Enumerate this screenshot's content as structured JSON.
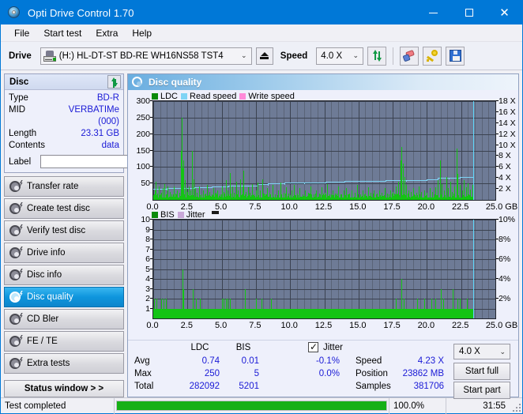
{
  "window": {
    "title": "Opti Drive Control 1.70",
    "icon": "disc-icon",
    "minimize": "minimize",
    "maximize": "maximize",
    "close": "close"
  },
  "menu": {
    "items": [
      "File",
      "Start test",
      "Extra",
      "Help"
    ]
  },
  "toolbar": {
    "drive_label": "Drive",
    "drive_value": "(H:)  HL-DT-ST BD-RE  WH16NS58 TST4",
    "eject_title": "Eject",
    "speed_label": "Speed",
    "speed_value": "4.0 X",
    "refresh_title": "refresh-icon",
    "erase_title": "erase-icon",
    "key_title": "key-icon",
    "save_title": "save-icon"
  },
  "disc_panel": {
    "title": "Disc",
    "refresh_icon": "refresh-icon",
    "rows": [
      {
        "key": "Type",
        "value": "BD-R"
      },
      {
        "key": "MID",
        "value": "VERBATIMe (000)"
      },
      {
        "key": "Length",
        "value": "23.31 GB"
      },
      {
        "key": "Contents",
        "value": "data"
      }
    ],
    "label_key": "Label",
    "label_value": "",
    "label_placeholder": ""
  },
  "nav": {
    "items": [
      {
        "label": "Transfer rate",
        "active": false
      },
      {
        "label": "Create test disc",
        "active": false
      },
      {
        "label": "Verify test disc",
        "active": false
      },
      {
        "label": "Drive info",
        "active": false
      },
      {
        "label": "Disc info",
        "active": false
      },
      {
        "label": "Disc quality",
        "active": true
      },
      {
        "label": "CD Bler",
        "active": false
      },
      {
        "label": "FE / TE",
        "active": false
      },
      {
        "label": "Extra tests",
        "active": false
      }
    ],
    "status_button": "Status window > >"
  },
  "main": {
    "title": "Disc quality",
    "icon": "disc-quality-icon"
  },
  "stats": {
    "col_ldc": "LDC",
    "col_bis": "BIS",
    "jitter_label": "Jitter",
    "jitter_checked": true,
    "rows": [
      {
        "name": "Avg",
        "ldc": "0.74",
        "bis": "0.01",
        "jitter": "-0.1%"
      },
      {
        "name": "Max",
        "ldc": "250",
        "bis": "5",
        "jitter": "0.0%"
      },
      {
        "name": "Total",
        "ldc": "282092",
        "bis": "5201",
        "jitter": ""
      }
    ],
    "speed_label": "Speed",
    "speed_value": "4.23 X",
    "position_label": "Position",
    "position_value": "23862 MB",
    "samples_label": "Samples",
    "samples_value": "381706",
    "speed_select": "4.0 X",
    "start_full": "Start full",
    "start_part": "Start part"
  },
  "statusbar": {
    "message": "Test completed",
    "progress_percent": "100.0%",
    "progress_value": 100,
    "elapsed": "31:55"
  },
  "colors": {
    "accent": "#0078d7",
    "ldc_green": "#14c414",
    "read_speed": "#7fd4f5",
    "write_speed": "#ff8ad8",
    "jitter": "#c9a8d8",
    "plot_bg": "#6e7b96",
    "value_blue": "#1a1ad6"
  },
  "chart_data": [
    {
      "type": "line",
      "id": "ldc-chart",
      "title": "Disc quality - LDC / Read speed",
      "legend": [
        {
          "label": "LDC",
          "color": "#0a8a0a"
        },
        {
          "label": "Read speed",
          "color": "#7fd4f5"
        },
        {
          "label": "Write speed",
          "color": "#ff8ad8"
        }
      ],
      "legend_position": "top-left",
      "xlabel": "GB",
      "xlim": [
        0,
        25
      ],
      "xticks": [
        "0.0",
        "2.5",
        "5.0",
        "7.5",
        "10.0",
        "12.5",
        "15.0",
        "17.5",
        "20.0",
        "22.5",
        "25.0 GB"
      ],
      "ylabel_left": "LDC",
      "ylim": [
        0,
        300
      ],
      "yticks": [
        50,
        100,
        150,
        200,
        250,
        300
      ],
      "ylabel_right": "Speed",
      "ylim_right": [
        0,
        18
      ],
      "yticks_right": [
        "2 X",
        "4 X",
        "6 X",
        "8 X",
        "10 X",
        "12 X",
        "14 X",
        "16 X",
        "18 X"
      ],
      "grid": true,
      "cursor_x": 23.4,
      "series": [
        {
          "name": "Read speed",
          "color": "#7fd4f5",
          "axis": "right",
          "x": [
            0.0,
            1.0,
            2.0,
            3.0,
            4.3,
            5.5,
            6.6,
            7.6,
            8.4,
            9.6,
            11.0,
            12.6,
            13.2,
            14.0,
            15.5,
            17.0,
            18.5,
            20.0,
            20.8,
            21.6,
            22.4,
            23.3
          ],
          "values": [
            1.85,
            2.05,
            2.2,
            2.25,
            2.4,
            2.5,
            2.55,
            2.7,
            2.95,
            3.05,
            3.15,
            3.3,
            3.35,
            3.4,
            3.45,
            3.5,
            3.6,
            3.65,
            3.95,
            4.0,
            4.15,
            4.2
          ]
        },
        {
          "name": "LDC",
          "color": "#14c414",
          "axis": "left",
          "note": "LDC error spikes sampled every ~0.06 GB; baseline near 5-10, max 250 at 2.15 GB",
          "spikes": [
            [
              0.05,
              18
            ],
            [
              0.12,
              30
            ],
            [
              0.2,
              55
            ],
            [
              0.3,
              20
            ],
            [
              0.42,
              40
            ],
            [
              0.55,
              22
            ],
            [
              0.68,
              35
            ],
            [
              0.8,
              48
            ],
            [
              0.92,
              18
            ],
            [
              1.05,
              40
            ],
            [
              1.2,
              24
            ],
            [
              1.35,
              18
            ],
            [
              1.5,
              42
            ],
            [
              1.62,
              20
            ],
            [
              1.75,
              30
            ],
            [
              1.88,
              22
            ],
            [
              2.02,
              150
            ],
            [
              2.1,
              250
            ],
            [
              2.16,
              95
            ],
            [
              2.22,
              120
            ],
            [
              2.3,
              60
            ],
            [
              2.4,
              35
            ],
            [
              2.5,
              25
            ],
            [
              2.6,
              40
            ],
            [
              2.72,
              28
            ],
            [
              2.85,
              150
            ],
            [
              2.95,
              62
            ],
            [
              3.05,
              35
            ],
            [
              3.2,
              22
            ],
            [
              3.35,
              40
            ],
            [
              3.5,
              18
            ],
            [
              3.65,
              30
            ],
            [
              3.8,
              20
            ],
            [
              3.95,
              45
            ],
            [
              4.1,
              24
            ],
            [
              4.25,
              18
            ],
            [
              4.4,
              35
            ],
            [
              4.55,
              22
            ],
            [
              4.7,
              30
            ],
            [
              4.85,
              18
            ],
            [
              5.0,
              42
            ],
            [
              5.15,
              24
            ],
            [
              5.3,
              60
            ],
            [
              5.45,
              30
            ],
            [
              5.6,
              82
            ],
            [
              5.75,
              40
            ],
            [
              5.9,
              22
            ],
            [
              6.05,
              55
            ],
            [
              6.2,
              30
            ],
            [
              6.35,
              62
            ],
            [
              6.5,
              40
            ],
            [
              6.6,
              90
            ],
            [
              6.75,
              25
            ],
            [
              6.9,
              38
            ],
            [
              7.05,
              22
            ],
            [
              7.2,
              48
            ],
            [
              7.35,
              18
            ],
            [
              7.5,
              28
            ],
            [
              7.65,
              52
            ],
            [
              7.8,
              30
            ],
            [
              7.95,
              62
            ],
            [
              8.1,
              20
            ],
            [
              8.3,
              35
            ],
            [
              8.5,
              22
            ],
            [
              8.7,
              45
            ],
            [
              8.9,
              18
            ],
            [
              9.1,
              30
            ],
            [
              9.3,
              52
            ],
            [
              9.5,
              22
            ],
            [
              9.7,
              38
            ],
            [
              9.9,
              18
            ],
            [
              10.1,
              28
            ],
            [
              10.3,
              45
            ],
            [
              10.5,
              20
            ],
            [
              10.7,
              35
            ],
            [
              10.9,
              18
            ],
            [
              11.1,
              30
            ],
            [
              11.3,
              22
            ],
            [
              11.5,
              40
            ],
            [
              11.7,
              18
            ],
            [
              11.9,
              28
            ],
            [
              12.1,
              20
            ],
            [
              12.3,
              38
            ],
            [
              12.5,
              22
            ],
            [
              12.7,
              48
            ],
            [
              12.9,
              18
            ],
            [
              13.1,
              30
            ],
            [
              13.3,
              20
            ],
            [
              13.5,
              42
            ],
            [
              13.7,
              18
            ],
            [
              13.9,
              28
            ],
            [
              14.1,
              35
            ],
            [
              14.3,
              20
            ],
            [
              14.5,
              30
            ],
            [
              14.7,
              22
            ],
            [
              14.9,
              45
            ],
            [
              15.1,
              18
            ],
            [
              15.3,
              28
            ],
            [
              15.5,
              20
            ],
            [
              15.7,
              38
            ],
            [
              15.9,
              22
            ],
            [
              16.1,
              30
            ],
            [
              16.3,
              18
            ],
            [
              16.5,
              28
            ],
            [
              16.7,
              22
            ],
            [
              16.9,
              35
            ],
            [
              17.1,
              20
            ],
            [
              17.3,
              30
            ],
            [
              17.5,
              25
            ],
            [
              17.7,
              40
            ],
            [
              17.9,
              55
            ],
            [
              18.05,
              120
            ],
            [
              18.15,
              162
            ],
            [
              18.25,
              110
            ],
            [
              18.35,
              70
            ],
            [
              18.5,
              45
            ],
            [
              18.65,
              30
            ],
            [
              18.8,
              25
            ],
            [
              19.0,
              35
            ],
            [
              19.2,
              22
            ],
            [
              19.4,
              40
            ],
            [
              19.6,
              25
            ],
            [
              19.8,
              30
            ],
            [
              20.0,
              22
            ],
            [
              20.2,
              35
            ],
            [
              20.4,
              25
            ],
            [
              20.6,
              38
            ],
            [
              20.8,
              60
            ],
            [
              20.95,
              120
            ],
            [
              21.1,
              48
            ],
            [
              21.25,
              30
            ],
            [
              21.4,
              70
            ],
            [
              21.55,
              35
            ],
            [
              21.7,
              55
            ],
            [
              21.85,
              25
            ],
            [
              22.0,
              40
            ],
            [
              22.15,
              155
            ],
            [
              22.25,
              80
            ],
            [
              22.4,
              45
            ],
            [
              22.55,
              30
            ],
            [
              22.7,
              60
            ],
            [
              22.85,
              38
            ],
            [
              23.0,
              50
            ],
            [
              23.15,
              32
            ],
            [
              23.3,
              45
            ]
          ]
        }
      ]
    },
    {
      "type": "line",
      "id": "bis-chart",
      "title": "Disc quality - BIS / Jitter",
      "legend": [
        {
          "label": "BIS",
          "color": "#0a8a0a"
        },
        {
          "label": "Jitter",
          "color": "#c9a8d8"
        }
      ],
      "legend_position": "top-left",
      "xlabel": "GB",
      "xlim": [
        0,
        25
      ],
      "xticks": [
        "0.0",
        "2.5",
        "5.0",
        "7.5",
        "10.0",
        "12.5",
        "15.0",
        "17.5",
        "20.0",
        "22.5",
        "25.0 GB"
      ],
      "ylabel_left": "BIS",
      "ylim": [
        0,
        10
      ],
      "yticks": [
        1,
        2,
        3,
        4,
        5,
        6,
        7,
        8,
        9,
        10
      ],
      "ylabel_right": "Jitter",
      "ylim_right": [
        0,
        10
      ],
      "yticks_right": [
        "2%",
        "4%",
        "6%",
        "8%",
        "10%"
      ],
      "grid": true,
      "cursor_x": 23.4,
      "series": [
        {
          "name": "BIS",
          "color": "#14c414",
          "axis": "left",
          "note": "BIS baseline 1, occasional spikes; max 5 at 2.15 GB",
          "spikes": [
            [
              0.08,
              2
            ],
            [
              0.25,
              2
            ],
            [
              0.6,
              2
            ],
            [
              0.75,
              2
            ],
            [
              0.9,
              2
            ],
            [
              2.15,
              5
            ],
            [
              2.2,
              3
            ],
            [
              2.9,
              3
            ],
            [
              3.1,
              2
            ],
            [
              3.4,
              2
            ],
            [
              5.0,
              2
            ],
            [
              5.15,
              2
            ],
            [
              5.3,
              2
            ],
            [
              5.45,
              2
            ],
            [
              5.6,
              2
            ],
            [
              6.7,
              3
            ],
            [
              7.5,
              2
            ],
            [
              7.9,
              2
            ],
            [
              8.6,
              2
            ],
            [
              17.7,
              2
            ],
            [
              18.15,
              4
            ],
            [
              18.3,
              2
            ],
            [
              19.3,
              2
            ],
            [
              19.8,
              2
            ],
            [
              20.3,
              2
            ],
            [
              20.6,
              2
            ],
            [
              21.0,
              3
            ],
            [
              21.2,
              2
            ],
            [
              21.9,
              3
            ],
            [
              22.2,
              2
            ],
            [
              22.4,
              2
            ],
            [
              22.9,
              2
            ]
          ]
        }
      ]
    }
  ]
}
